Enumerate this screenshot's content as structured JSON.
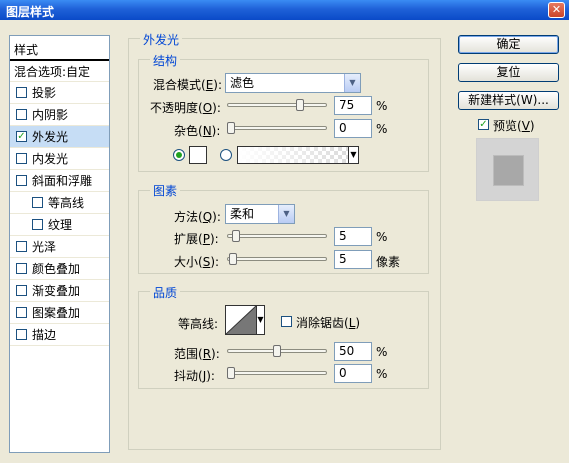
{
  "window": {
    "title": "图层样式",
    "close_glyph": "✕"
  },
  "style_list": {
    "header": "样式",
    "blend_options": "混合选项:自定",
    "items": [
      {
        "label": "投影",
        "checked": false,
        "indent": false
      },
      {
        "label": "内阴影",
        "checked": false,
        "indent": false
      },
      {
        "label": "外发光",
        "checked": true,
        "indent": false,
        "active": true
      },
      {
        "label": "内发光",
        "checked": false,
        "indent": false
      },
      {
        "label": "斜面和浮雕",
        "checked": false,
        "indent": false
      },
      {
        "label": "等高线",
        "checked": false,
        "indent": true
      },
      {
        "label": "纹理",
        "checked": false,
        "indent": true
      },
      {
        "label": "光泽",
        "checked": false,
        "indent": false
      },
      {
        "label": "颜色叠加",
        "checked": false,
        "indent": false
      },
      {
        "label": "渐变叠加",
        "checked": false,
        "indent": false
      },
      {
        "label": "图案叠加",
        "checked": false,
        "indent": false
      },
      {
        "label": "描边",
        "checked": false,
        "indent": false
      }
    ]
  },
  "outer_glow": {
    "legend": "外发光",
    "structure": {
      "legend": "结构",
      "blend_mode_label": "混合模式(",
      "blend_mode_key": "E",
      "blend_mode_value": "滤色",
      "opacity_label": "不透明度(",
      "opacity_key": "O",
      "opacity_value": "75",
      "opacity_level": 0.75,
      "noise_label": "杂色(",
      "noise_key": "N",
      "noise_value": "0",
      "noise_level": 0,
      "unit": "%",
      "color_mode": "solid",
      "glow_color": "#ffffff"
    },
    "elements": {
      "legend": "图素",
      "method_label": "方法(",
      "method_key": "Q",
      "method_value": "柔和",
      "spread_label": "扩展(",
      "spread_key": "P",
      "spread_value": "5",
      "spread_unit": "%",
      "spread_level": 0.05,
      "size_label": "大小(",
      "size_key": "S",
      "size_value": "5",
      "size_unit": "像素",
      "size_level": 0.02
    },
    "quality": {
      "legend": "品质",
      "contour_label": "等高线:",
      "anti_alias_label": "消除锯齿(",
      "anti_alias_key": "L",
      "anti_alias_checked": false,
      "range_label": "范围(",
      "range_key": "R",
      "range_value": "50",
      "range_level": 0.5,
      "jitter_label": "抖动(",
      "jitter_key": "J",
      "jitter_value": "0",
      "jitter_level": 0,
      "unit": "%"
    }
  },
  "buttons": {
    "ok": "确定",
    "reset": "复位",
    "new_style": "新建样式(W)..."
  },
  "preview": {
    "label": "预览(",
    "key": "V",
    "checked": true
  },
  "colors": {
    "accent": "#0046d5",
    "titlebar": "#1f61d8",
    "active_row": "#c6ddf5"
  }
}
